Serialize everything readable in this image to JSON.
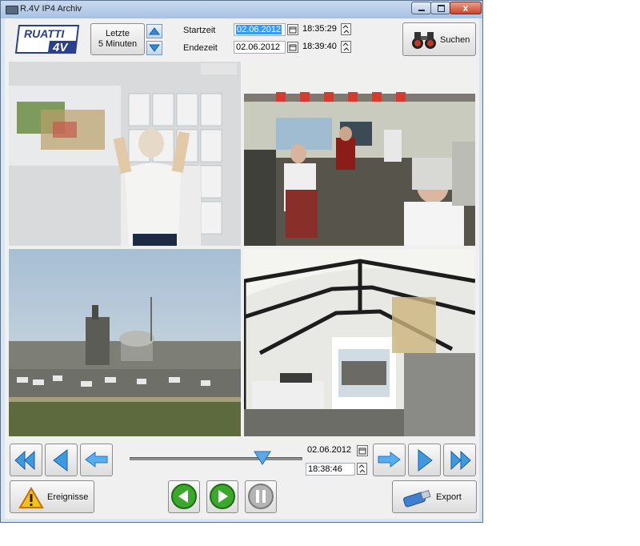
{
  "window": {
    "title": "R.4V IP4 Archiv",
    "close_glyph": "x"
  },
  "header": {
    "logo_top": "RUATTI",
    "logo_bottom": "4V",
    "last_button_line1": "Letzte",
    "last_button_line2": "5 Minuten",
    "start_label": "Startzeit",
    "end_label": "Endezeit",
    "start_date": "02.06.2012",
    "start_time": "18:35:29",
    "end_date": "02.06.2012",
    "end_time": "18:39:40",
    "search_label": "Suchen"
  },
  "cameras": [
    {
      "name": "cam-1",
      "scene": "Mann am Whiteboard"
    },
    {
      "name": "cam-2",
      "scene": "Einsatzzentrale"
    },
    {
      "name": "cam-3",
      "scene": "Industrieanlage"
    },
    {
      "name": "cam-4",
      "scene": "Zelt"
    }
  ],
  "playback": {
    "date": "02.06.2012",
    "time": "18:38:46",
    "position": 0.77
  },
  "footer": {
    "events_label": "Ereignisse",
    "export_label": "Export"
  },
  "colors": {
    "accent": "#3e8fd8",
    "logo_blue": "#2b3f8f",
    "play_green": "#3aa82a"
  }
}
